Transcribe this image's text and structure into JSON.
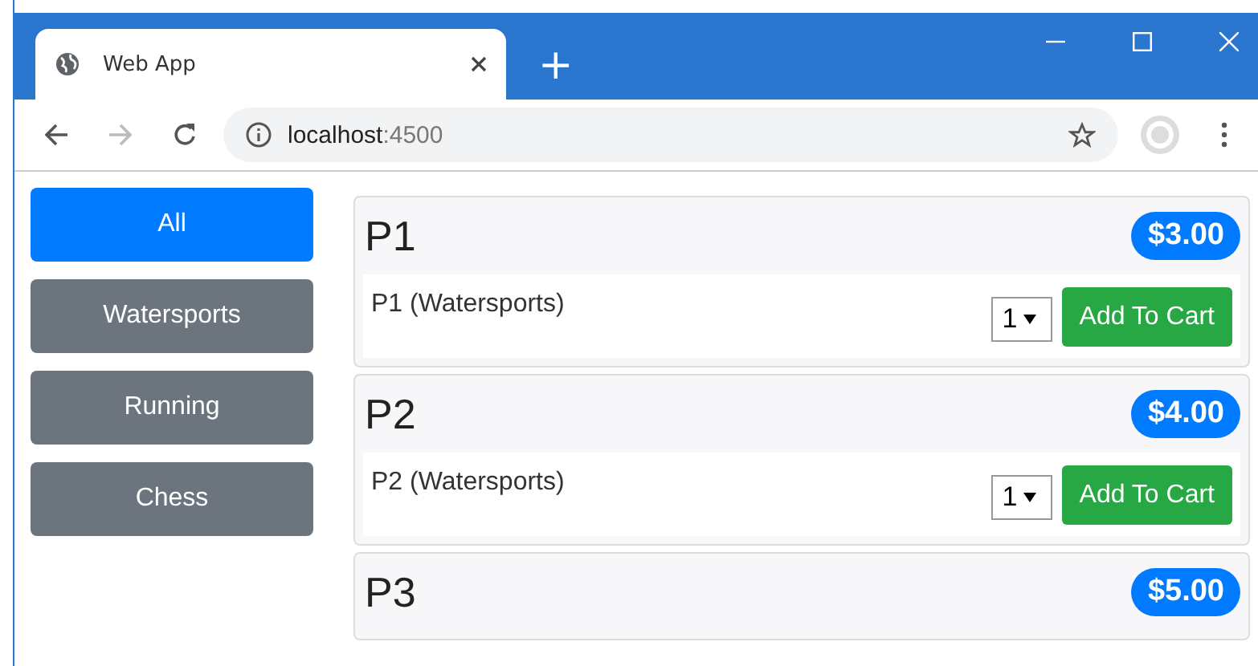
{
  "browser": {
    "tab_title": "Web App",
    "new_tab": "+",
    "address": {
      "host": "localhost",
      "port": ":4500"
    }
  },
  "categories": [
    {
      "label": "All",
      "selected": true
    },
    {
      "label": "Watersports",
      "selected": false
    },
    {
      "label": "Running",
      "selected": false
    },
    {
      "label": "Chess",
      "selected": false
    }
  ],
  "products": [
    {
      "name": "P1",
      "price": "$3.00",
      "description": "P1 (Watersports)",
      "quantity": "1",
      "button": "Add To Cart"
    },
    {
      "name": "P2",
      "price": "$4.00",
      "description": "P2 (Watersports)",
      "quantity": "1",
      "button": "Add To Cart"
    },
    {
      "name": "P3",
      "price": "$5.00"
    }
  ]
}
